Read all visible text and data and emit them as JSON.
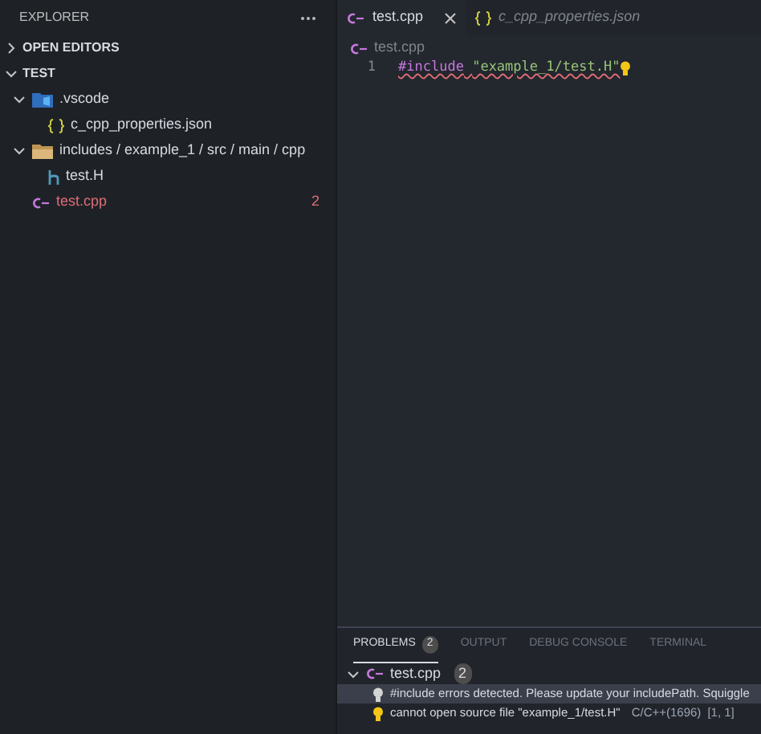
{
  "explorer": {
    "title": "EXPLORER",
    "sections": [
      {
        "label": "OPEN EDITORS",
        "expanded": false
      },
      {
        "label": "TEST",
        "expanded": true,
        "children": [
          {
            "kind": "vscode-folder",
            "label": ".vscode",
            "expanded": true,
            "children": [
              {
                "kind": "json",
                "label": "c_cpp_properties.json"
              }
            ]
          },
          {
            "kind": "folder",
            "label": "includes / example_1 / src / main / cpp",
            "expanded": true,
            "children": [
              {
                "kind": "header",
                "label": "test.H"
              }
            ]
          },
          {
            "kind": "cpp",
            "label": "test.cpp",
            "error": true,
            "count": "2"
          }
        ]
      }
    ]
  },
  "tabs": [
    {
      "label": "test.cpp",
      "kind": "cpp",
      "selected": true,
      "preview": false
    },
    {
      "label": "c_cpp_properties.json",
      "kind": "json",
      "selected": false,
      "preview": true
    }
  ],
  "breadcrumb": "test.cpp",
  "code": [
    {
      "number": "1",
      "directive": "#include",
      "string": "\"example_1/test.H\"",
      "squiggle": true
    }
  ],
  "panel": {
    "tabs": [
      {
        "label": "PROBLEMS",
        "count": "2",
        "selected": true
      },
      {
        "label": "OUTPUT",
        "selected": false
      },
      {
        "label": "DEBUG CONSOLE",
        "selected": false
      },
      {
        "label": "TERMINAL",
        "selected": false
      }
    ],
    "group": {
      "file": "test.cpp",
      "count": "2",
      "expanded": true,
      "items": [
        {
          "kind": "gray",
          "selected": true,
          "message": "#include errors detected. Please update your includePath. Squiggle"
        },
        {
          "kind": "yellow",
          "selected": false,
          "message": "cannot open source file \"example_1/test.H\"",
          "source": "C/C++(1696)",
          "location": "[1, 1]"
        }
      ]
    }
  }
}
